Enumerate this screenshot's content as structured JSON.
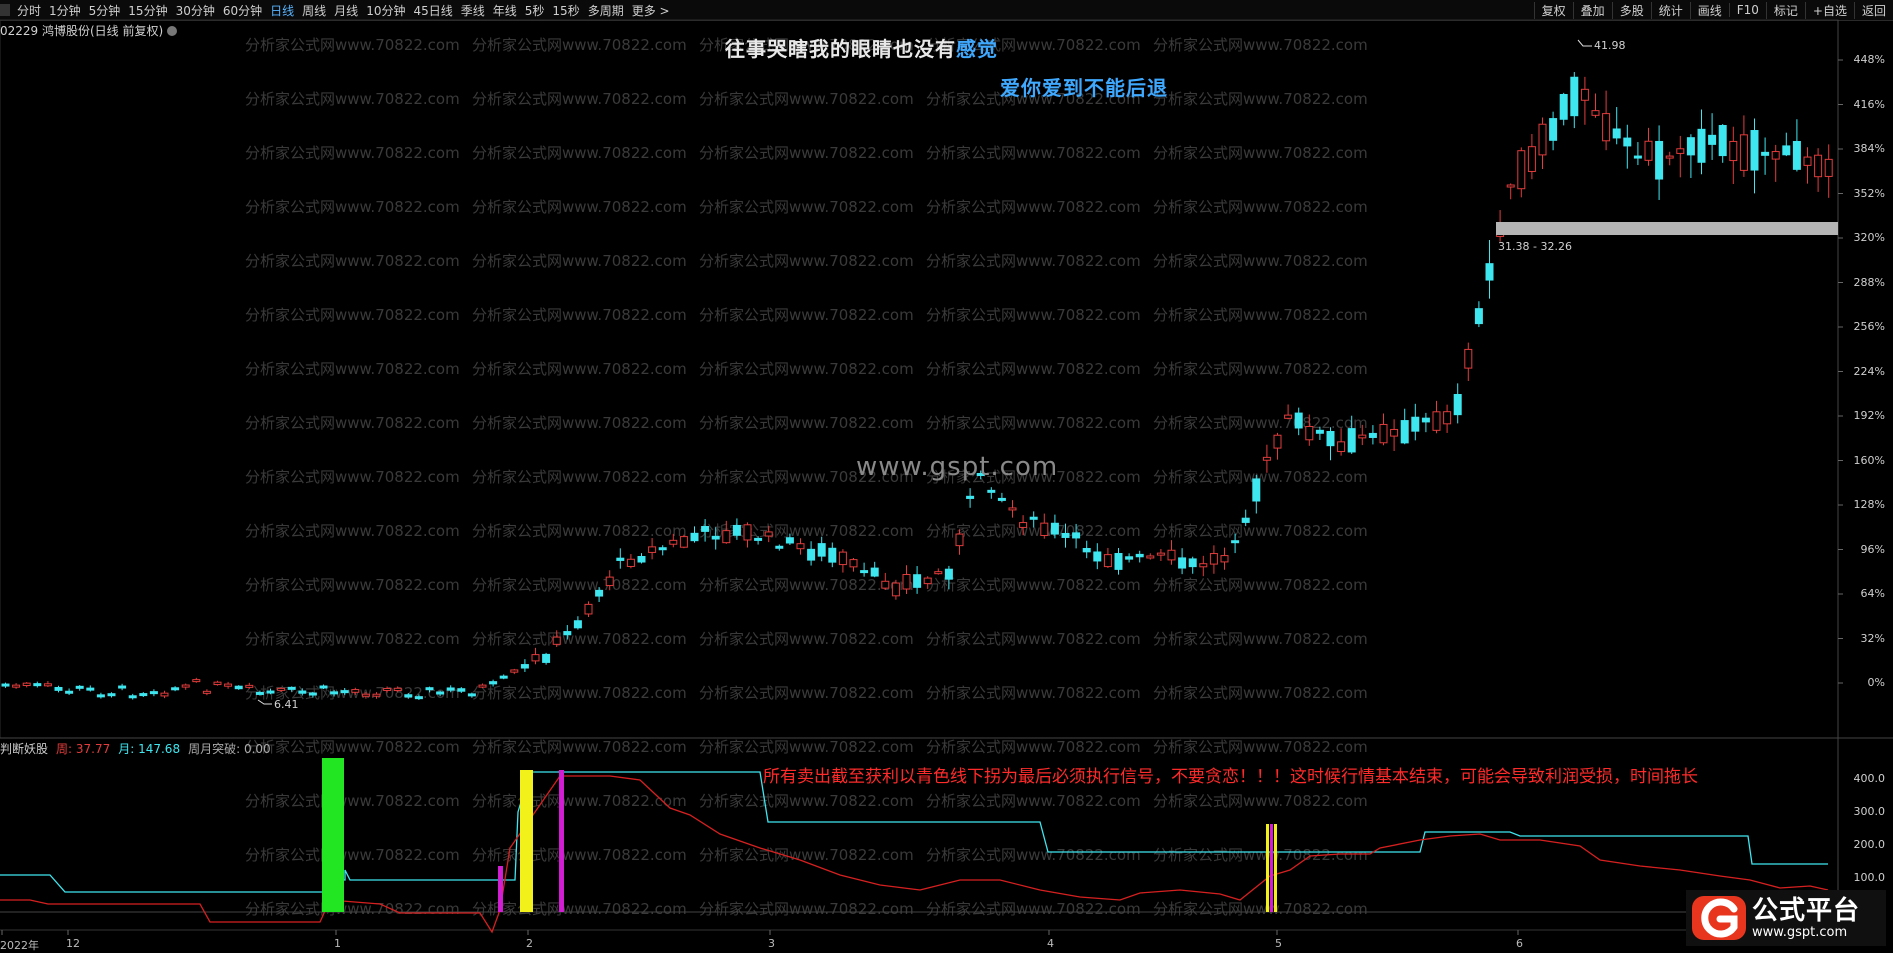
{
  "toolbar": {
    "periods": [
      "分时",
      "1分钟",
      "5分钟",
      "15分钟",
      "30分钟",
      "60分钟",
      "日线",
      "周线",
      "月线",
      "10分钟",
      "45日线",
      "季线",
      "年线",
      "5秒",
      "15秒",
      "多周期",
      "更多 >"
    ],
    "active_period": "日线",
    "right_buttons": [
      "复权",
      "叠加",
      "多股",
      "统计",
      "画线",
      "F10",
      "标记",
      "+自选",
      "返回"
    ]
  },
  "stock": {
    "title": "02229 鸿博股份(日线 前复权)"
  },
  "lyrics": {
    "line1_white": "往事哭瞎我的眼睛也没有",
    "line1_blue": "感觉",
    "line2": "爱你爱到不能后退"
  },
  "watermark": {
    "center": "www.gspt.com",
    "repeat": "分析家公式网www.70822.com"
  },
  "annotations": {
    "high": "41.98",
    "low": "6.41",
    "zone": "31.38 - 32.26"
  },
  "price_axis": [
    "448%",
    "416%",
    "384%",
    "352%",
    "320%",
    "288%",
    "256%",
    "224%",
    "192%",
    "160%",
    "128%",
    "96%",
    "64%",
    "32%",
    "0%"
  ],
  "indicator": {
    "name": "判断妖股",
    "week_label": "周: 37.77",
    "month_label": "月: 147.68",
    "breakout_label": "周月突破: 0.00",
    "axis": [
      "400.0",
      "300.0",
      "200.0",
      "100.0"
    ],
    "warning": "所有卖出截至获利以青色线下拐为最后必须执行信号，不要贪恋！！！这时候行情基本结束，可能会导致利润受损，时间拖长"
  },
  "time_axis": [
    "2022年",
    "12",
    "1",
    "2",
    "3",
    "4",
    "5",
    "6"
  ],
  "logo": {
    "name": "公式平台",
    "url": "www.gspt.com"
  },
  "colors": {
    "up": "#e23c3c",
    "down": "#3ee6f0",
    "cyan_line": "#3ee6f0",
    "red_line": "#d62020",
    "green_bar": "#22e622",
    "yellow_bar": "#f2f21a",
    "magenta_bar": "#d21ed2",
    "blue_text": "#3fa9ff"
  }
}
